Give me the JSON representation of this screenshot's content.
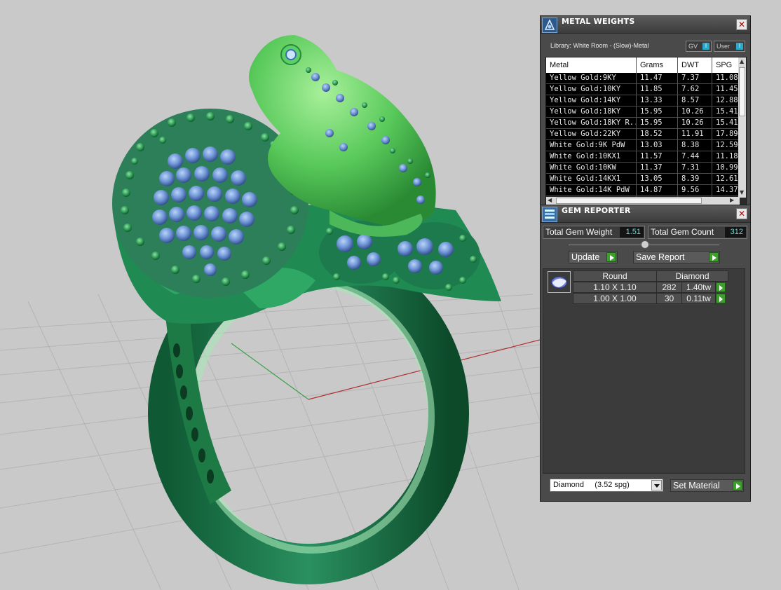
{
  "metal_weights": {
    "title": "METAL WEIGHTS",
    "library": "Library: White Room - (Slow)-Metal",
    "gv_toggle": "GV",
    "user_toggle": "User",
    "columns": [
      "Metal",
      "Grams",
      "DWT",
      "SPG"
    ],
    "rows": [
      [
        "Yellow Gold:9KY",
        "11.47",
        "7.37",
        "11.08"
      ],
      [
        "Yellow Gold:10KY",
        "11.85",
        "7.62",
        "11.45"
      ],
      [
        "Yellow Gold:14KY",
        "13.33",
        "8.57",
        "12.88"
      ],
      [
        "Yellow Gold:18KY",
        "15.95",
        "10.26",
        "15.41"
      ],
      [
        "Yellow Gold:18KY R...",
        "15.95",
        "10.26",
        "15.41"
      ],
      [
        "Yellow Gold:22KY",
        "18.52",
        "11.91",
        "17.89"
      ],
      [
        "White Gold:9K PdW",
        "13.03",
        "8.38",
        "12.59"
      ],
      [
        "White Gold:10KX1",
        "11.57",
        "7.44",
        "11.18"
      ],
      [
        "White Gold:10KW",
        "11.37",
        "7.31",
        "10.99"
      ],
      [
        "White Gold:14KX1",
        "13.05",
        "8.39",
        "12.61"
      ],
      [
        "White Gold:14K PdW",
        "14.87",
        "9.56",
        "14.37"
      ]
    ]
  },
  "gem_reporter": {
    "title": "GEM REPORTER",
    "total_weight_label": "Total Gem Weight",
    "total_weight_value": "1.51",
    "total_count_label": "Total Gem Count",
    "total_count_value": "312",
    "update_label": "Update",
    "save_report_label": "Save Report",
    "shape_header": "Round",
    "material_header": "Diamond",
    "gems": [
      {
        "size": "1.10 X 1.10",
        "count": "282",
        "tw": "1.40tw"
      },
      {
        "size": "1.00 X 1.00",
        "count": "30",
        "tw": "0.11tw"
      }
    ],
    "material_select": "Diamond     (3.52 spg)",
    "set_material_label": "Set Material"
  },
  "icons": [
    "metal-weights-logo-icon",
    "gem-reporter-logo-icon",
    "close-icon",
    "dropdown-arrow-icon",
    "go-arrow-icon",
    "round-gem-icon"
  ]
}
